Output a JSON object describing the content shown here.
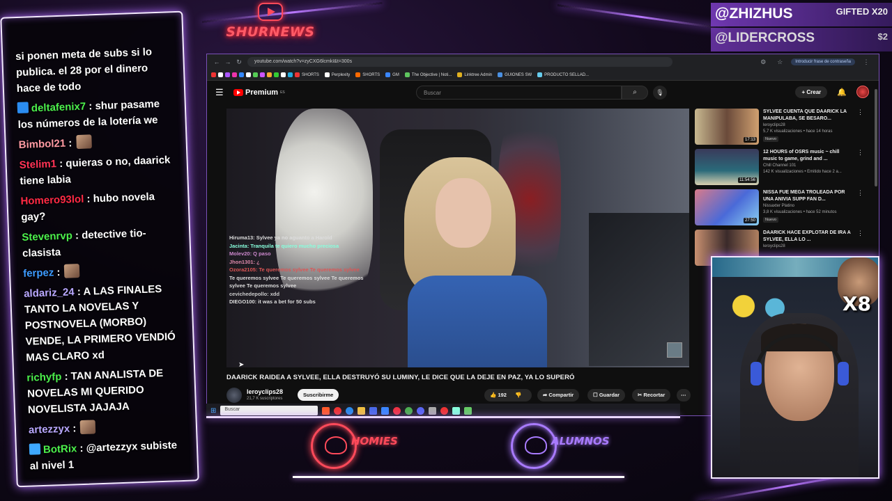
{
  "colors": {
    "neon_purple": "#b06cff",
    "neon_red": "#ff4a5a",
    "chat_green": "#4cf04c",
    "chat_pink": "#ff3355",
    "chat_blue": "#3d9bff"
  },
  "overlay": {
    "top_logo_text": "SHURNEWS",
    "top_logo_icon": "youtube-play-icon",
    "subs": [
      {
        "name": "@ZHIZHUS",
        "tag": "GIFTED X20"
      },
      {
        "name": "@LIDERCROSS",
        "tag": "$2"
      }
    ],
    "bottom_left_label": "HOMIES",
    "bottom_right_label": "ALUMNOS",
    "multiplier": "X8"
  },
  "chat": [
    {
      "user": "",
      "text": "si ponen meta de subs si lo publica. el 28 por el dinero hace de todo",
      "color": "#ffffff",
      "badge": ""
    },
    {
      "user": "deltafenix7",
      "text": ": shur pasame los números de la lotería we",
      "color": "#4cf04c",
      "badge": "sub-badge"
    },
    {
      "user": "Bimbol21",
      "text": ":",
      "color": "#ff9aa2",
      "badge": "",
      "emote": true
    },
    {
      "user": "Stelim1",
      "text": ": quieras o no, daarick tiene labia",
      "color": "#ff3355",
      "badge": ""
    },
    {
      "user": "Homero93lol",
      "text": ": hubo novela gay?",
      "color": "#ff2a44",
      "badge": ""
    },
    {
      "user": "Stevenrvp",
      "text": ": detective tio-clasista",
      "color": "#4cf04c",
      "badge": ""
    },
    {
      "user": "ferpez",
      "text": ":",
      "color": "#3d9bff",
      "badge": "",
      "emote": true
    },
    {
      "user": "aldariz_24",
      "text": ": A LAS FINALES TANTO LA NOVELAS Y POSTNOVELA (MORBO) VENDE, LA PRIMERO VENDIÓ MAS CLARO xd",
      "color": "#b9a8ff",
      "badge": ""
    },
    {
      "user": "richyfp",
      "text": ": TAN ANALISTA DE NOVELAS MI QUERIDO NOVELISTA JAJAJA",
      "color": "#4cf04c",
      "badge": ""
    },
    {
      "user": "artezzyx",
      "text": ":",
      "color": "#b9a8ff",
      "badge": "",
      "emote": true
    },
    {
      "user": "BotRix",
      "text": ": @artezzyx subiste al nivel 1",
      "color": "#4cf04c",
      "badge": "bot-badge"
    }
  ],
  "browser": {
    "url": "youtube.com/watch?v=zyCXG6lcmkI&t=300s",
    "password_btn": "Introducir frase de contraseña",
    "bookmarks": [
      "SHORTS",
      "Perplexity",
      "SHORTS",
      "GM",
      "The Objective | Noti...",
      "Linktree Admin",
      "GUIONES SW",
      "PRODUCTO SELLAD..."
    ]
  },
  "youtube": {
    "logo": "Premium",
    "logo_region": "ES",
    "search_placeholder": "Buscar",
    "create_label": "Crear",
    "video": {
      "title": "DAARICK RAIDEA A SYLVEE, ELLA DESTRUYÓ SU LUMINY, LE DICE QUE LA DEJE EN PAZ, YA LO SUPERÓ",
      "channel": "leroyclips28",
      "subscribers": "21,7 K suscriptores",
      "subscribe_label": "Suscribirme",
      "likes": "192",
      "share_label": "Compartir",
      "save_label": "Guardar",
      "clip_label": "Recortar"
    },
    "video_chat": [
      "Hiruma13: Sylvee ya no aguanto a Harold",
      "Jacinta: Tranquila te quiero mucho preciosa",
      "Molev20: Q paso",
      "Jhon1301: ¿",
      "Ozora2105: Te queremos sylvee  Te queremos sylvee",
      "Te queremos sylvee  Te queremos sylvee  Te queremos",
      "sylvee  Te queremos sylvee",
      "cevichedepollo: xdd",
      "DIEGO100: it was a bet for 50 subs"
    ],
    "recommendations": [
      {
        "title": "SYLVEE CUENTA QUE DAARICK LA MANIPULABA, SE BESARO...",
        "channel": "leroyclips28",
        "meta": "5,7 K visualizaciones • hace 14 horas",
        "badge": "Nuevo",
        "duration": "17:13"
      },
      {
        "title": "12 HOURS of OSRS music ~ chill music to game, grind and ...",
        "channel": "Chill Channel 101",
        "meta": "142 K visualizaciones • Emitido hace 2 a...",
        "badge": "",
        "duration": "11:54:56"
      },
      {
        "title": "NISSA FUE MEGA TROLEADA POR UNA ANIVIA SUPP FAN D...",
        "channel": "Nissaxter Platino",
        "meta": "3,8 K visualizaciones • hace 52 minutos",
        "badge": "Nuevo",
        "duration": "27:50"
      },
      {
        "title": "DAARICK HACE EXPLOTAR DE IRA A SYLVEE, ELLA LO ...",
        "channel": "leroyclips28",
        "meta": "",
        "badge": "",
        "duration": ""
      }
    ]
  },
  "taskbar": {
    "search_placeholder": "Buscar"
  }
}
